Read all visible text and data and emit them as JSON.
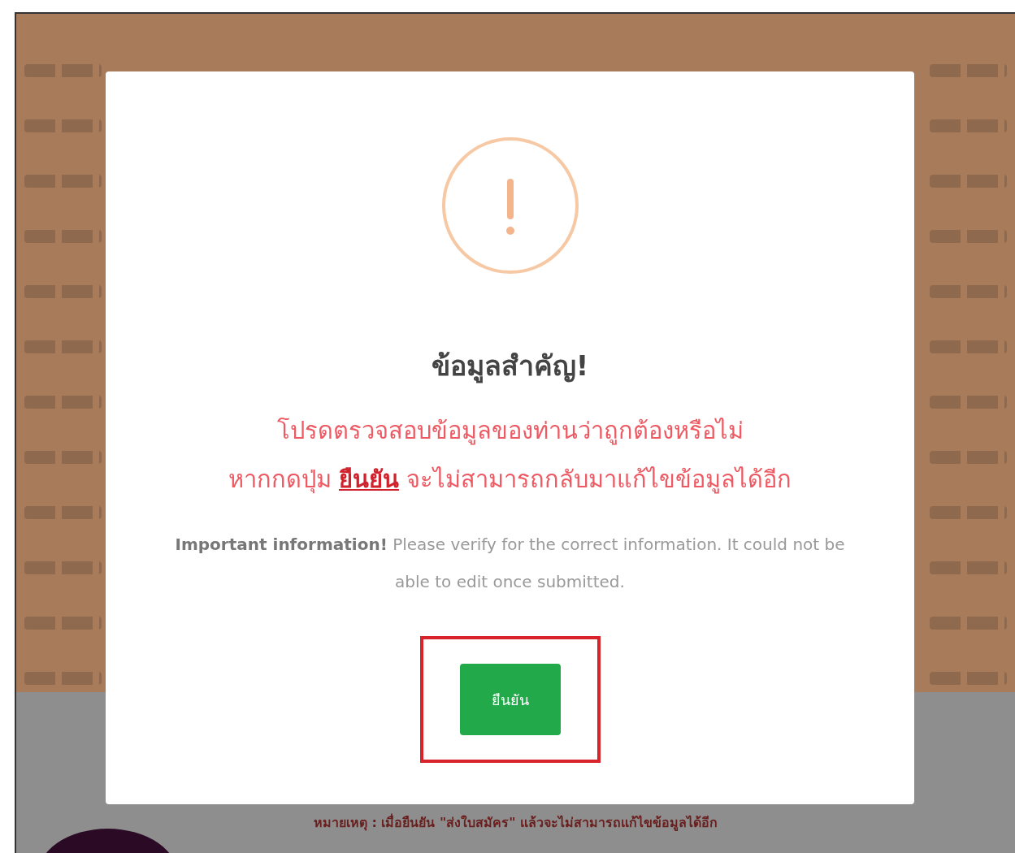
{
  "dialog": {
    "title": "ข้อมูลสำคัญ!",
    "warning_lines": [
      "โปรดตรวจสอบข้อมูลของท่านว่าถูกต้องหรือไม่",
      "หากกดปุ่ม **ยืนยัน** จะไม่สามารถกลับมาแก้ไขข้อมูลได้อีก"
    ],
    "english_note": "**Important information!** Please verify for the correct information. It could not be able to edit once submitted.",
    "confirm_button": "ยืนยัน"
  },
  "footer_note": "หมายเหตุ : เมื่อยืนยัน \"ส่งใบสมัคร\" แล้วจะไม่สามารถแก้ไขข้อมูลได้อีก"
}
